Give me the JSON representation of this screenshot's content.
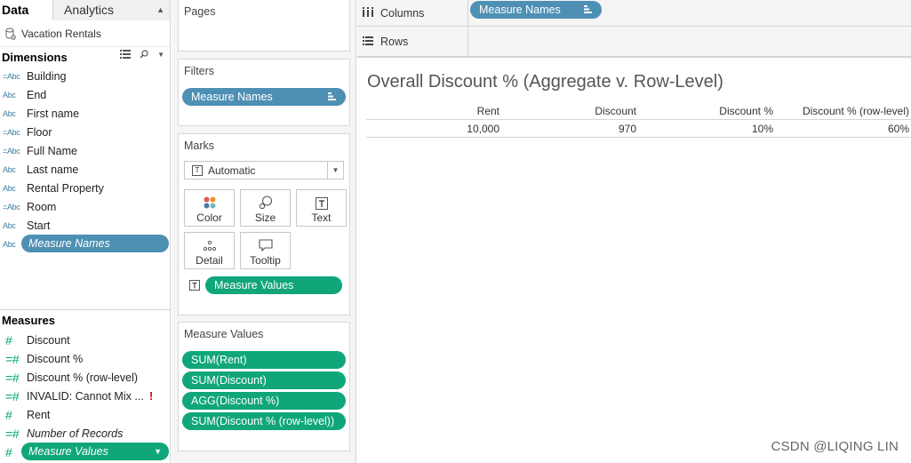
{
  "data_pane": {
    "tabs": {
      "data": "Data",
      "analytics": "Analytics"
    },
    "datasource": "Vacation Rentals",
    "dimensions": {
      "header": "Dimensions",
      "items": [
        {
          "type": "=Abc",
          "name": "Building"
        },
        {
          "type": "Abc",
          "name": "End"
        },
        {
          "type": "Abc",
          "name": "First name"
        },
        {
          "type": "=Abc",
          "name": "Floor"
        },
        {
          "type": "=Abc",
          "name": "Full Name"
        },
        {
          "type": "Abc",
          "name": "Last name"
        },
        {
          "type": "Abc",
          "name": "Rental Property"
        },
        {
          "type": "=Abc",
          "name": "Room"
        },
        {
          "type": "Abc",
          "name": "Start"
        },
        {
          "type": "Abc",
          "name": "Measure Names"
        }
      ]
    },
    "measures": {
      "header": "Measures",
      "items": [
        {
          "type": "#",
          "name": "Discount"
        },
        {
          "type": "=#",
          "name": "Discount %"
        },
        {
          "type": "=#",
          "name": "Discount % (row-level)"
        },
        {
          "type": "=#",
          "name": "INVALID: Cannot Mix ...",
          "warning": "!"
        },
        {
          "type": "#",
          "name": "Rent"
        },
        {
          "type": "=#",
          "name": "Number of Records"
        },
        {
          "type": "#",
          "name": "Measure Values"
        }
      ]
    }
  },
  "shelves": {
    "pages": "Pages",
    "filters": {
      "title": "Filters",
      "pill": "Measure Names"
    },
    "marks": {
      "title": "Marks",
      "type": "Automatic",
      "buttons": [
        "Color",
        "Size",
        "Text",
        "Detail",
        "Tooltip"
      ],
      "text_pill": "Measure Values"
    },
    "measure_values": {
      "title": "Measure Values",
      "pills": [
        "SUM(Rent)",
        "SUM(Discount)",
        "AGG(Discount %)",
        "SUM(Discount % (row-level))"
      ]
    },
    "columns": {
      "label": "Columns",
      "pill": "Measure Names"
    },
    "rows": {
      "label": "Rows"
    }
  },
  "view": {
    "title": "Overall Discount % (Aggregate v. Row-Level)",
    "table": {
      "headers": [
        "Rent",
        "Discount",
        "Discount %",
        "Discount % (row-level)"
      ],
      "values": [
        "10,000",
        "970",
        "10%",
        "60%"
      ]
    }
  },
  "watermark": "CSDN @LIQING LIN",
  "colors": {
    "dimension_blue": "#4e90b4",
    "measure_green": "#10a67a"
  },
  "chart_data": {
    "type": "table",
    "title": "Overall Discount % (Aggregate v. Row-Level)",
    "columns": [
      "Rent",
      "Discount",
      "Discount %",
      "Discount % (row-level)"
    ],
    "rows": [
      [
        "10,000",
        "970",
        "10%",
        "60%"
      ]
    ]
  }
}
